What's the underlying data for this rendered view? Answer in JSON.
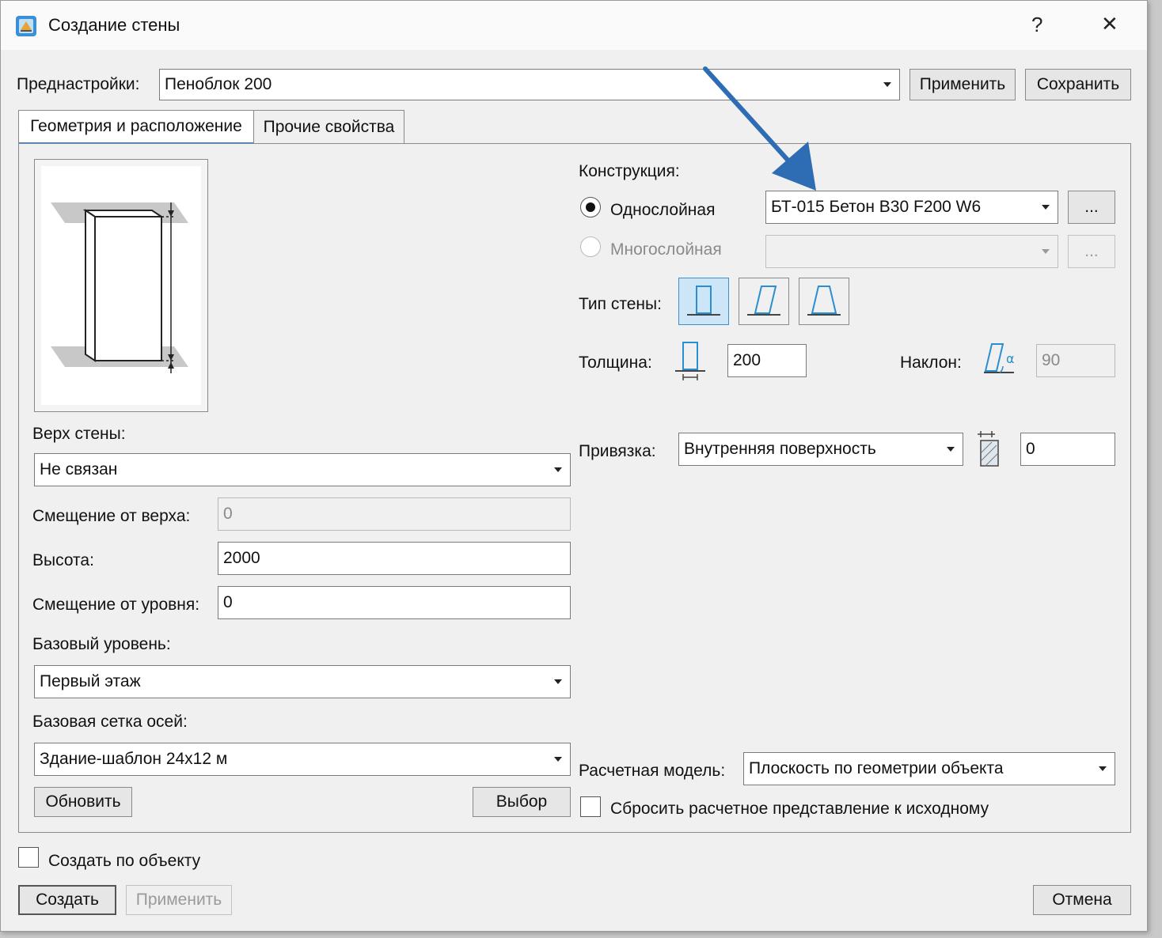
{
  "window": {
    "title": "Создание стены",
    "help_label": "?",
    "close_label": "✕"
  },
  "presets": {
    "label": "Преднастройки:",
    "value": "Пеноблок 200",
    "apply_label": "Применить",
    "save_label": "Сохранить"
  },
  "tabs": [
    {
      "label": "Геометрия и расположение",
      "active": true
    },
    {
      "label": "Прочие свойства",
      "active": false
    }
  ],
  "left": {
    "top_label": "Верх стены:",
    "top_value": "Не связан",
    "top_offset_label": "Смещение от верха:",
    "top_offset_value": "0",
    "height_label": "Высота:",
    "height_value": "2000",
    "level_offset_label": "Смещение от уровня:",
    "level_offset_value": "0",
    "base_level_label": "Базовый уровень:",
    "base_level_value": "Первый этаж",
    "grid_label": "Базовая сетка осей:",
    "grid_value": "Здание-шаблон 24x12 м",
    "refresh_label": "Обновить",
    "select_label": "Выбор"
  },
  "right": {
    "construction_label": "Конструкция:",
    "single_layer_label": "Однослойная",
    "single_layer_value": "БТ-015 Бетон B30 F200 W6",
    "multi_layer_label": "Многослойная",
    "multi_layer_value": "",
    "browse_label": "...",
    "wall_type_label": "Тип стены:",
    "thickness_label": "Толщина:",
    "thickness_value": "200",
    "slope_label": "Наклон:",
    "slope_value": "90",
    "binding_label": "Привязка:",
    "binding_value": "Внутренняя поверхность",
    "binding_offset_value": "0",
    "calc_model_label": "Расчетная модель:",
    "calc_model_value": "Плоскость по геометрии объекта",
    "reset_calc_label": "Сбросить расчетное представление к исходному"
  },
  "bottom": {
    "create_by_object_label": "Создать по объекту",
    "create_label": "Создать",
    "apply_label": "Применить",
    "cancel_label": "Отмена"
  },
  "colors": {
    "accent": "#2a7fd4",
    "annotation_arrow": "#2e6db4",
    "active_type_bg": "#cde6f7"
  },
  "icons": [
    "app-icon",
    "wall-preview-icon",
    "wall-vertical-icon",
    "wall-inclined-icon",
    "wall-trapezoid-icon",
    "thickness-icon",
    "slope-icon",
    "binding-icon",
    "annotation-arrow"
  ]
}
